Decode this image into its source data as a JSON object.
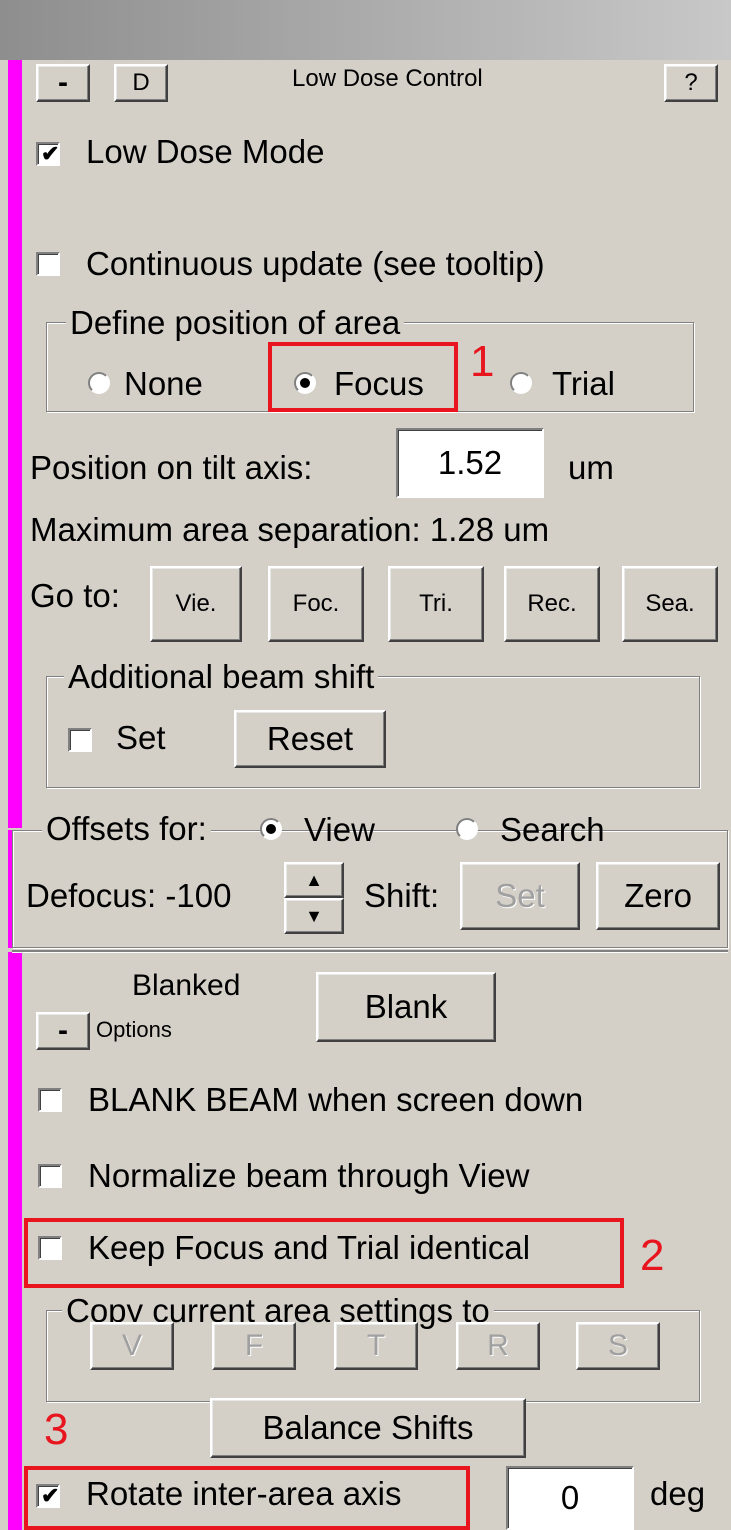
{
  "lowdose": {
    "collapse_label": "-",
    "d_label": "D",
    "title": "Low Dose Control",
    "help_label": "?",
    "low_dose_mode": {
      "label": "Low Dose Mode",
      "checked": true
    },
    "continuous_update": {
      "label": "Continuous update (see tooltip)",
      "checked": false
    },
    "define_position": {
      "legend": "Define position of area",
      "options": [
        "None",
        "Focus",
        "Trial"
      ],
      "selected": "Focus"
    },
    "position_label": "Position on tilt axis:",
    "position_value": "1.52",
    "position_unit": "um",
    "max_separation": "Maximum area separation:  1.28 um",
    "goto_label": "Go to:",
    "goto_buttons": [
      "Vie.",
      "Foc.",
      "Tri.",
      "Rec.",
      "Sea."
    ],
    "beam_shift": {
      "legend": "Additional beam shift",
      "set_label": "Set",
      "reset_label": "Reset"
    },
    "offsets": {
      "legend": "Offsets for:",
      "view_label": "View",
      "search_label": "Search",
      "selected": "View",
      "defocus_label": "Defocus: -100",
      "shift_label": "Shift:",
      "set_label": "Set",
      "zero_label": "Zero"
    }
  },
  "blank_panel": {
    "status": "Blanked",
    "blank_button": "Blank",
    "collapse_label": "-",
    "options_label": "Options",
    "blank_when_down": "BLANK BEAM when screen down",
    "normalize_view": "Normalize beam through View",
    "keep_identical": "Keep Focus and Trial identical",
    "copy": {
      "legend": "Copy current area settings to",
      "buttons": [
        "V",
        "F",
        "T",
        "R",
        "S"
      ]
    },
    "balance_shifts": "Balance Shifts",
    "rotate_axis": {
      "label": "Rotate inter-area axis",
      "checked": true
    },
    "rotate_value": "0",
    "rotate_unit": "deg"
  },
  "annotations": [
    "1",
    "2",
    "3"
  ],
  "colors": {
    "background": "#d4d0c8",
    "strip": "#ff00ff",
    "annotation": "#e8141e"
  }
}
